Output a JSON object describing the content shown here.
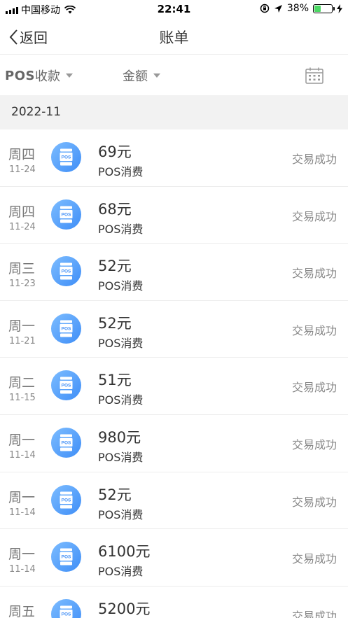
{
  "status_bar": {
    "carrier": "中国移动",
    "time": "22:41",
    "battery_text": "38%",
    "battery_level": 0.38
  },
  "nav": {
    "back_label": "返回",
    "title": "账单"
  },
  "filters": {
    "type_bold": "POS",
    "type_rest": "收款",
    "amount_label": "金额"
  },
  "month_label": "2022-11",
  "transactions": [
    {
      "weekday": "周四",
      "date": "11-24",
      "amount": "69元",
      "type": "POS消费",
      "status": "交易成功"
    },
    {
      "weekday": "周四",
      "date": "11-24",
      "amount": "68元",
      "type": "POS消费",
      "status": "交易成功"
    },
    {
      "weekday": "周三",
      "date": "11-23",
      "amount": "52元",
      "type": "POS消费",
      "status": "交易成功"
    },
    {
      "weekday": "周一",
      "date": "11-21",
      "amount": "52元",
      "type": "POS消费",
      "status": "交易成功"
    },
    {
      "weekday": "周二",
      "date": "11-15",
      "amount": "51元",
      "type": "POS消费",
      "status": "交易成功"
    },
    {
      "weekday": "周一",
      "date": "11-14",
      "amount": "980元",
      "type": "POS消费",
      "status": "交易成功"
    },
    {
      "weekday": "周一",
      "date": "11-14",
      "amount": "52元",
      "type": "POS消费",
      "status": "交易成功"
    },
    {
      "weekday": "周一",
      "date": "11-14",
      "amount": "6100元",
      "type": "POS消费",
      "status": "交易成功"
    },
    {
      "weekday": "周五",
      "date": "",
      "amount": "5200元",
      "type": "",
      "status": "交易成功"
    }
  ],
  "icon_label": "POS",
  "colors": {
    "icon_gradient_start": "#7cbcff",
    "icon_gradient_end": "#3f8ef7",
    "battery_green": "#4cd964"
  }
}
